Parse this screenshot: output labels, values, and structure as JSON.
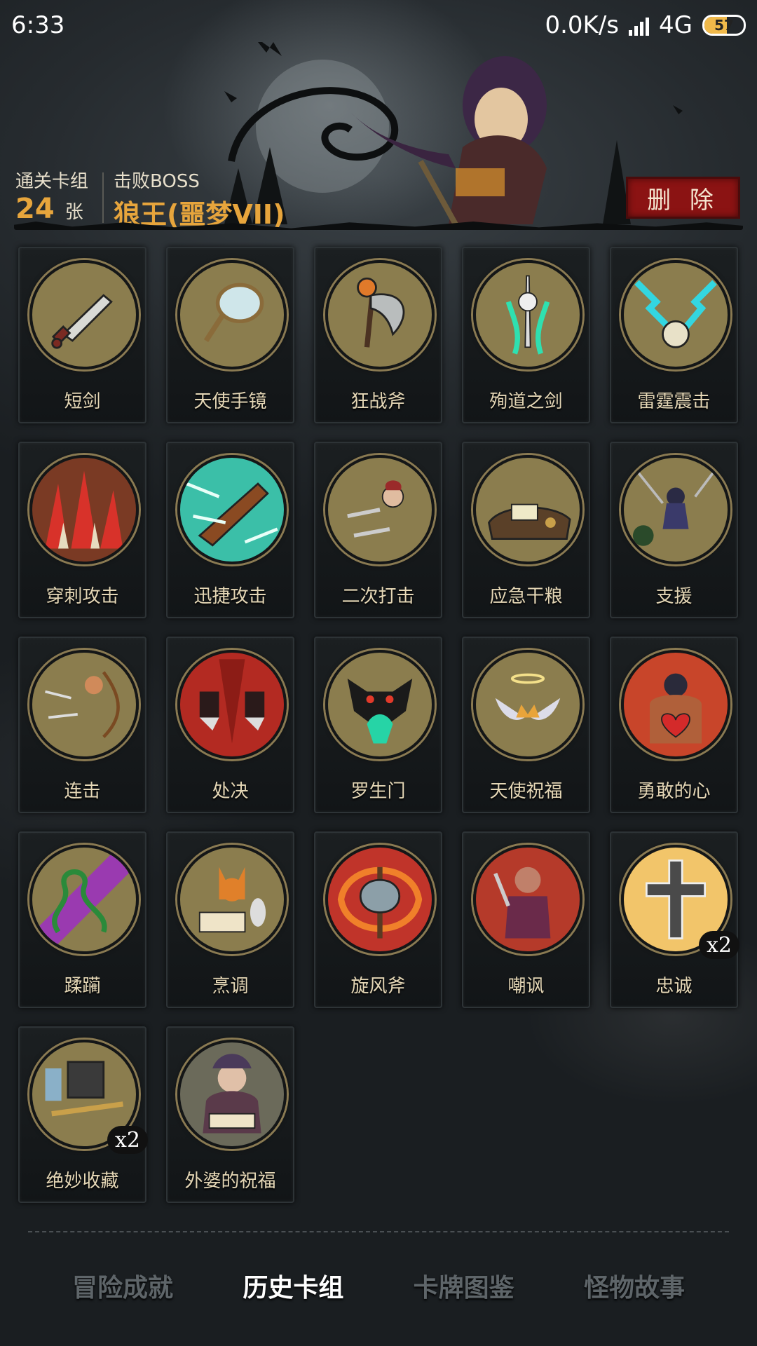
{
  "status_bar": {
    "time": "6:33",
    "network_speed": "0.0K/s",
    "signal_type": "4G",
    "battery": "57",
    "battery_level": 0.57
  },
  "header": {
    "cleared_deck_label": "通关卡组",
    "cleared_deck_count": "24",
    "cleared_deck_unit": "张",
    "boss_label": "击败BOSS",
    "boss_name": "狼王(噩梦VII)",
    "delete_label": "删 除"
  },
  "cards": [
    {
      "name": "短剑",
      "icon": "dagger-icon",
      "bg": "#8b7d4e"
    },
    {
      "name": "天使手镜",
      "icon": "hand-mirror-icon",
      "bg": "#8b7d4e"
    },
    {
      "name": "狂战斧",
      "icon": "battle-axe-icon",
      "bg": "#8b7d4e"
    },
    {
      "name": "殉道之剑",
      "icon": "martyr-sword-icon",
      "bg": "#8b7d4e"
    },
    {
      "name": "雷霆震击",
      "icon": "thunder-strike-icon",
      "bg": "#8b7d4e"
    },
    {
      "name": "穿刺攻击",
      "icon": "spike-attack-icon",
      "bg": "#7a3a24"
    },
    {
      "name": "迅捷攻击",
      "icon": "swift-attack-icon",
      "bg": "#3bbfa8"
    },
    {
      "name": "二次打击",
      "icon": "double-strike-icon",
      "bg": "#8b7d4e"
    },
    {
      "name": "应急干粮",
      "icon": "emergency-rations-icon",
      "bg": "#8b7d4e"
    },
    {
      "name": "支援",
      "icon": "support-icon",
      "bg": "#8b7d4e"
    },
    {
      "name": "连击",
      "icon": "combo-archer-icon",
      "bg": "#8b7d4e"
    },
    {
      "name": "处决",
      "icon": "execution-icon",
      "bg": "#b32a22"
    },
    {
      "name": "罗生门",
      "icon": "rashomon-demon-icon",
      "bg": "#8b7d4e"
    },
    {
      "name": "天使祝福",
      "icon": "angel-blessing-icon",
      "bg": "#8b7d4e"
    },
    {
      "name": "勇敢的心",
      "icon": "brave-heart-icon",
      "bg": "#c8452a"
    },
    {
      "name": "蹂躏",
      "icon": "ravage-thorns-icon",
      "bg": "#8b7d4e"
    },
    {
      "name": "烹调",
      "icon": "cooking-fox-icon",
      "bg": "#8b7d4e"
    },
    {
      "name": "旋风斧",
      "icon": "whirlwind-axe-icon",
      "bg": "#c0342a"
    },
    {
      "name": "嘲讽",
      "icon": "taunt-icon",
      "bg": "#b53a2a"
    },
    {
      "name": "忠诚",
      "icon": "loyalty-cross-icon",
      "bg": "#f2c56a",
      "badge": "x2"
    },
    {
      "name": "绝妙收藏",
      "icon": "collection-icon",
      "bg": "#8b7d4e",
      "badge": "x2"
    },
    {
      "name": "外婆的祝福",
      "icon": "grandma-blessing-icon",
      "bg": "#6b6a5a"
    }
  ],
  "tabs": [
    {
      "label": "冒险成就",
      "active": false
    },
    {
      "label": "历史卡组",
      "active": true
    },
    {
      "label": "卡牌图鉴",
      "active": false
    },
    {
      "label": "怪物故事",
      "active": false
    }
  ]
}
